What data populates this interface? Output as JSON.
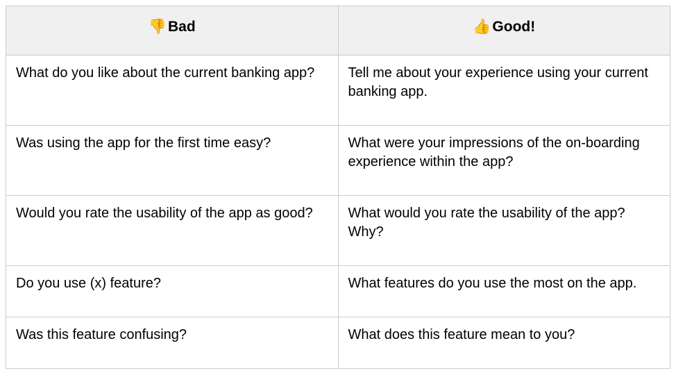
{
  "table": {
    "headers": {
      "bad": {
        "emoji": "👎",
        "label": "Bad"
      },
      "good": {
        "emoji": "👍",
        "label": "Good!"
      }
    },
    "rows": [
      {
        "bad": "What do you like about the current banking app?",
        "good": "Tell me about your experience using your current banking app."
      },
      {
        "bad": "Was using the app for the first time easy?",
        "good": "What were your impressions of the on-boarding experience within the app?"
      },
      {
        "bad": "Would you rate the usability of the app as good?",
        "good": "What would you rate the usability of the app? Why?"
      },
      {
        "bad": "Do you use (x) feature?",
        "good": "What features do you use the most on the app."
      },
      {
        "bad": "Was this feature confusing?",
        "good": "What does this feature mean to you?"
      }
    ]
  }
}
